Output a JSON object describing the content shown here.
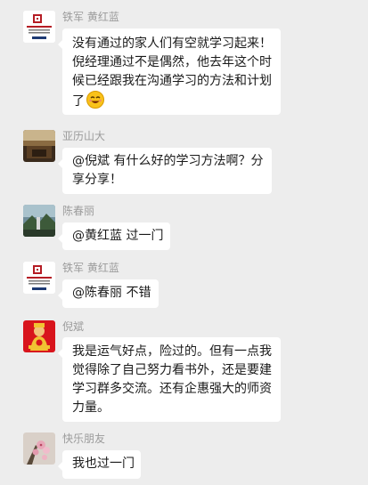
{
  "messages": [
    {
      "sender": "铁军  黄红蓝",
      "avatar": "school-logo-avatar",
      "lines": [
        "没有通过的家人们有空就学习起来！",
        "倪经理通过不是偶然，他去年这个时",
        "候已经跟我在沟通学习的方法和计划",
        "了"
      ],
      "emoji": "smiling-face-emoji"
    },
    {
      "sender": "亚历山大",
      "avatar": "photo-avatar-room",
      "lines": [
        "@倪斌 有什么好的学习方法啊？分",
        "享分享！"
      ]
    },
    {
      "sender": "陈春丽",
      "avatar": "photo-avatar-landscape",
      "lines": [
        "@黄红蓝 过一门"
      ]
    },
    {
      "sender": "铁军  黄红蓝",
      "avatar": "school-logo-avatar",
      "lines": [
        "@陈春丽 不错"
      ]
    },
    {
      "sender": "倪斌",
      "avatar": "fortune-god-avatar",
      "lines": [
        "我是运气好点，险过的。但有一点我",
        "觉得除了自己努力看书外，还是要建",
        "学习群多交流。还有企惠强大的师资",
        "力量。"
      ]
    },
    {
      "sender": "快乐朋友",
      "avatar": "flower-photo-avatar",
      "lines": [
        "我也过一门"
      ]
    }
  ],
  "colors": {
    "background": "#ededed",
    "bubble": "#ffffff",
    "sender_name": "#9b9b9b",
    "text": "#1a1a1a"
  }
}
